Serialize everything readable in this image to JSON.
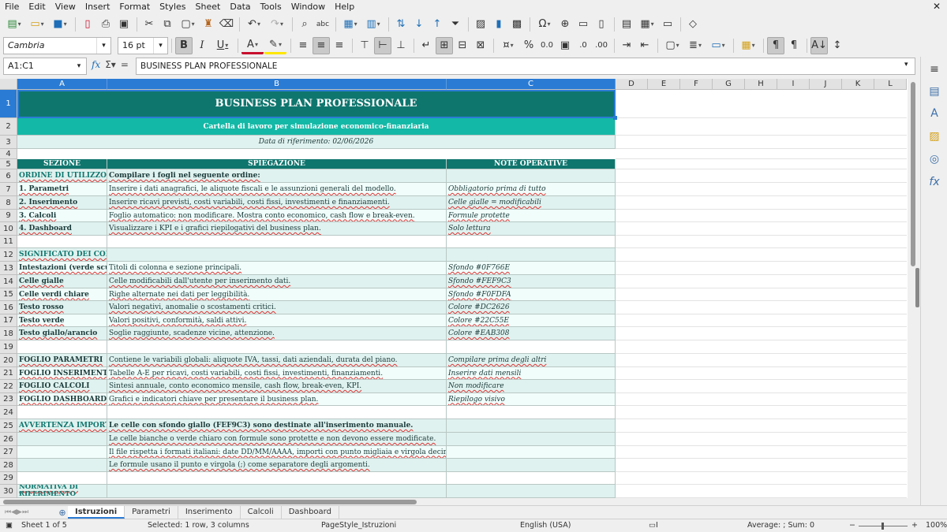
{
  "menu": [
    "File",
    "Edit",
    "View",
    "Insert",
    "Format",
    "Styles",
    "Sheet",
    "Data",
    "Tools",
    "Window",
    "Help"
  ],
  "toolbar": {
    "font_name": "Cambria",
    "font_size": "16 pt"
  },
  "formula_bar": {
    "name_box": "A1:C1",
    "formula": "BUSINESS PLAN PROFESSIONALE"
  },
  "columns": [
    "A",
    "B",
    "C",
    "D",
    "E",
    "F",
    "G",
    "H",
    "I",
    "J",
    "K",
    "L"
  ],
  "selected_columns": [
    "A",
    "B",
    "C"
  ],
  "colors": {
    "dark_teal": "#0F766E",
    "medium_teal": "#14B8A6",
    "light_teal": "#E0F2EF",
    "mint": "#F0FDFA",
    "red": "#DC2626",
    "green": "#22C55E",
    "amber": "#EAB308",
    "yellow": "#FEF9C3",
    "selection_blue": "#2A7BD4"
  },
  "sheet": {
    "title": "BUSINESS PLAN PROFESSIONALE",
    "subtitle": "Cartella di lavoro per simulazione economico-finanziaria",
    "ref_date": "Data di riferimento: 02/06/2026",
    "headers": [
      "SEZIONE",
      "SPIEGAZIONE",
      "NOTE OPERATIVE"
    ],
    "rows": [
      {
        "n": "1",
        "a": "",
        "b": "",
        "c": ""
      },
      {
        "n": "2",
        "a": "",
        "b": "",
        "c": ""
      },
      {
        "n": "3",
        "a": "",
        "b": "",
        "c": ""
      },
      {
        "n": "4",
        "a": "",
        "b": "",
        "c": ""
      },
      {
        "n": "5",
        "a": "",
        "b": "",
        "c": ""
      },
      {
        "n": "6",
        "a": "ORDINE DI UTILIZZO",
        "b": "Compilare i fogli nel seguente ordine:",
        "c": ""
      },
      {
        "n": "7",
        "a": "1. Parametri",
        "b": "Inserire i dati anagrafici, le aliquote fiscali e le assunzioni generali del modello.",
        "c": "Obbligatorio prima di tutto"
      },
      {
        "n": "8",
        "a": "2. Inserimento",
        "b": "Inserire ricavi previsti, costi variabili, costi fissi, investimenti e finanziamenti.",
        "c": "Celle gialle = modificabili"
      },
      {
        "n": "9",
        "a": "3. Calcoli",
        "b": "Foglio automatico: non modificare. Mostra conto economico, cash flow e break-even.",
        "c": "Formule protette"
      },
      {
        "n": "10",
        "a": "4. Dashboard",
        "b": "Visualizzare i KPI e i grafici riepilogativi del business plan.",
        "c": "Solo lettura"
      },
      {
        "n": "11",
        "a": "",
        "b": "",
        "c": ""
      },
      {
        "n": "12",
        "a": "SIGNIFICATO DEI COLORI",
        "b": "",
        "c": ""
      },
      {
        "n": "13",
        "a": "Intestazioni (verde scuro)",
        "b": "Titoli di colonna e sezione principali.",
        "c": "Sfondo #0F766E"
      },
      {
        "n": "14",
        "a": "Celle gialle",
        "b": "Celle modificabili dall'utente per inserimento dati.",
        "c": "Sfondo #FEF9C3"
      },
      {
        "n": "15",
        "a": "Celle verdi chiare",
        "b": "Righe alternate nei dati per leggibilità.",
        "c": "Sfondo #F0FDFA"
      },
      {
        "n": "16",
        "a": "Testo rosso",
        "b": "Valori negativi, anomalie o scostamenti critici.",
        "c": "Colore #DC2626"
      },
      {
        "n": "17",
        "a": "Testo verde",
        "b": "Valori positivi, conformità, saldi attivi.",
        "c": "Colore #22C55E"
      },
      {
        "n": "18",
        "a": "Testo giallo/arancio",
        "b": "Soglie raggiunte, scadenze vicine, attenzione.",
        "c": "Colore #EAB308"
      },
      {
        "n": "19",
        "a": "",
        "b": "",
        "c": ""
      },
      {
        "n": "20",
        "a": "FOGLIO PARAMETRI",
        "b": "Contiene le variabili globali: aliquote IVA, tassi, dati aziendali, durata del piano.",
        "c": "Compilare prima degli altri"
      },
      {
        "n": "21",
        "a": "FOGLIO INSERIMENTO",
        "b": "Tabelle A-E per ricavi, costi variabili, costi fissi, investimenti, finanziamenti.",
        "c": "Inserire dati mensili"
      },
      {
        "n": "22",
        "a": "FOGLIO CALCOLI",
        "b": "Sintesi annuale, conto economico mensile, cash flow, break-even, KPI.",
        "c": "Non modificare"
      },
      {
        "n": "23",
        "a": "FOGLIO DASHBOARD",
        "b": "Grafici e indicatori chiave per presentare il business plan.",
        "c": "Riepilogo visivo"
      },
      {
        "n": "24",
        "a": "",
        "b": "",
        "c": ""
      },
      {
        "n": "25",
        "a": "AVVERTENZA IMPORTANTE",
        "b": "Le celle con sfondo giallo (FEF9C3) sono destinate all'inserimento manuale.",
        "c": ""
      },
      {
        "n": "26",
        "a": "",
        "b": "Le celle bianche o verde chiaro con formule sono protette e non devono essere modificate.",
        "c": ""
      },
      {
        "n": "27",
        "a": "",
        "b": "Il file rispetta i formati italiani: date DD/MM/AAAA, importi con punto migliaia e virgola decimale.",
        "c": ""
      },
      {
        "n": "28",
        "a": "",
        "b": "Le formule usano il punto e virgola (;) come separatore degli argomenti.",
        "c": ""
      },
      {
        "n": "29",
        "a": "",
        "b": "",
        "c": ""
      },
      {
        "n": "30",
        "a": "NORMATIVA DI RIFERIMENTO",
        "b": "",
        "c": ""
      }
    ]
  },
  "tabs": [
    "Istruzioni",
    "Parametri",
    "Inserimento",
    "Calcoli",
    "Dashboard"
  ],
  "active_tab": "Istruzioni",
  "status": {
    "sheet": "Sheet 1 of 5",
    "selection": "Selected: 1 row, 3 columns",
    "page_style": "PageStyle_Istruzioni",
    "language": "English (USA)",
    "stats": "Average: ; Sum: 0",
    "zoom": "100%"
  }
}
